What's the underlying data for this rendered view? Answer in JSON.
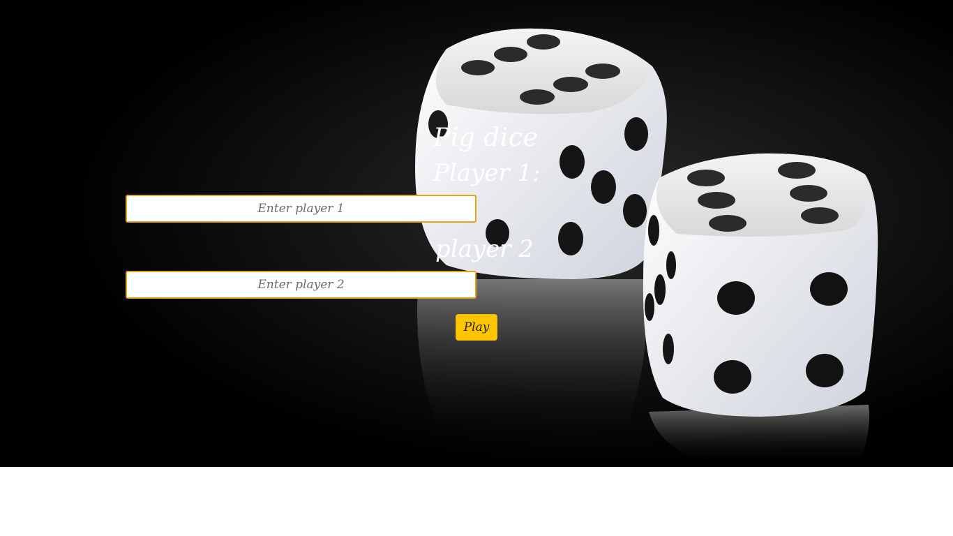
{
  "app": {
    "title": "Pig dice"
  },
  "form": {
    "player1": {
      "label": "Player 1:",
      "placeholder": "Enter player 1",
      "value": ""
    },
    "player2": {
      "label": "player 2",
      "placeholder": "Enter player 2",
      "value": ""
    },
    "play_label": "Play"
  },
  "colors": {
    "background": "#000000",
    "page": "#ffffff",
    "input_border": "#e8a21a",
    "button": "#fdc500",
    "text": "#ffffff"
  },
  "background_image": {
    "icon": "dice-photo"
  }
}
